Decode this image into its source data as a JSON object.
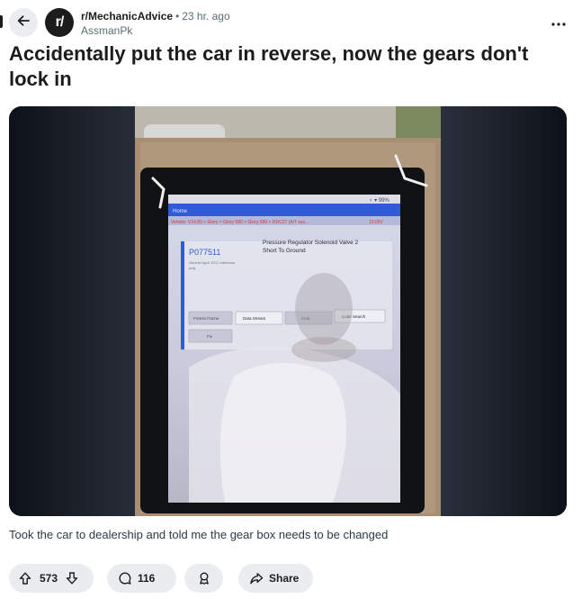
{
  "header": {
    "subreddit": "r/MechanicAdvice",
    "separator": "•",
    "time": "23 hr. ago",
    "author": "AssmanPk",
    "avatar_text": "r/"
  },
  "post": {
    "title": "Accidentally put the car in reverse, now the gears don't lock in",
    "body": "Took the car to dealership and told me the gear box needs to be changed"
  },
  "screen": {
    "status": "♀ ▾ 99%",
    "breadcrumb": "Vehicle: V14.80 > Glory > Glory 580 > Glory 580 > RDC27 (A/T sys...",
    "voltage": "13.65V",
    "dtc_code": "P077511",
    "dtc_desc_1": "Pressure Regulator Solenoid Valve 2",
    "dtc_desc_2": "Short To Ground",
    "dtc_meta_1": "Generic type: DTC reference",
    "dtc_meta_2": "only",
    "btn_freeze": "Freeze Frame",
    "btn_data": "Data Stream",
    "btn_help": "Help",
    "btn_code": "Code Search",
    "btn_fix": "Fix"
  },
  "actions": {
    "votes": "573",
    "comments": "116",
    "share": "Share"
  },
  "icons": {
    "back": "arrow-left-icon",
    "more": "more-horizontal-icon",
    "upvote": "arrow-up-icon",
    "downvote": "arrow-down-icon",
    "comment": "comment-bubble-icon",
    "award": "award-ribbon-icon",
    "share": "share-arrow-icon"
  },
  "colors": {
    "pill_bg": "#eaedef",
    "text": "#1c1c1c",
    "meta": "#576f76",
    "scanner_header": "#2f5bd6"
  }
}
